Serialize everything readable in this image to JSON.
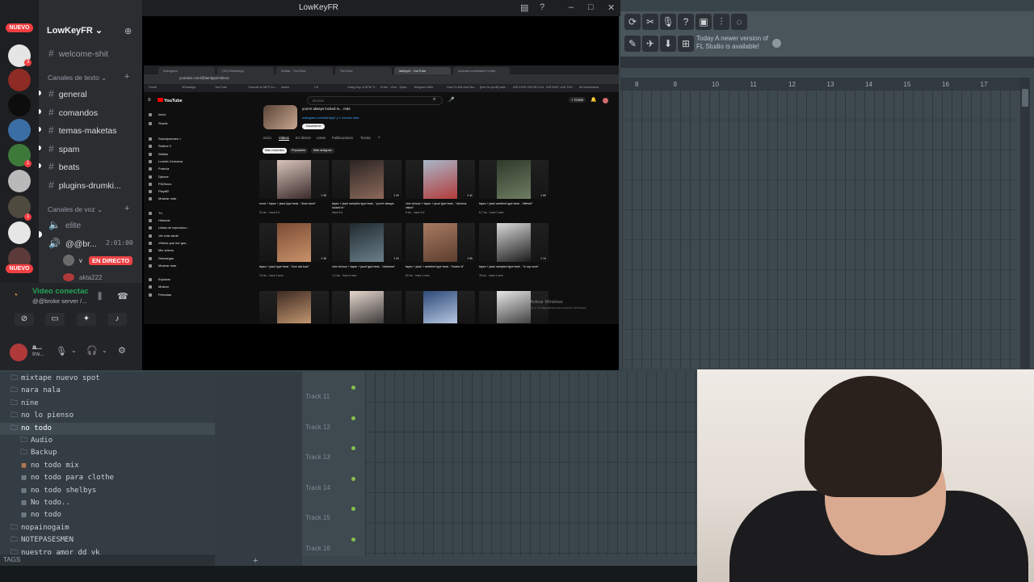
{
  "window": {
    "title": "LowKeyFR"
  },
  "discord": {
    "guild_name": "LowKeyFR ⌄",
    "nuevo_label": "NUEVO",
    "top_channel": "welcome-shit",
    "text_category": "Canales de texto ⌄",
    "text_channels": [
      "general",
      "comandos",
      "temas-maketas",
      "spam",
      "beats",
      "plugins-drumki..."
    ],
    "voice_category": "Canales de voz ⌄",
    "voice_channels": [
      "elite",
      "@@br..."
    ],
    "voice_time": "2:01:00",
    "live_user": "v",
    "live_label": "EN DIRECTO",
    "other_voice_user": "akta222",
    "server_badges": [
      "3",
      "1",
      "1"
    ],
    "voice_status": "Video conectac",
    "voice_server": "@@broke server /...",
    "user": {
      "name": "a...",
      "status": "Inv..."
    }
  },
  "fl": {
    "news_line1": "Today  A newer version of",
    "news_line2": "FL Studio is available!",
    "ruler": [
      "8",
      "9",
      "10",
      "11",
      "12",
      "13",
      "14",
      "15",
      "16",
      "17"
    ],
    "tracks": [
      "Track 11",
      "Track 12",
      "Track 13",
      "Track 14",
      "Track 15",
      "Track 16"
    ],
    "tags_label": "TAGS",
    "browser": [
      {
        "label": "mixtape nuevo spot",
        "icon": "folder",
        "indent": 0
      },
      {
        "label": "nara nala",
        "icon": "folder",
        "indent": 0
      },
      {
        "label": "nine",
        "icon": "folder",
        "indent": 0
      },
      {
        "label": "no lo pienso",
        "icon": "folder",
        "indent": 0
      },
      {
        "label": "no todo",
        "icon": "folder",
        "indent": 0,
        "selected": true
      },
      {
        "label": "Audio",
        "icon": "folder",
        "indent": 1
      },
      {
        "label": "Backup",
        "icon": "folder",
        "indent": 1
      },
      {
        "label": "no todo mix",
        "icon": "audio",
        "indent": 1
      },
      {
        "label": "no todo para clothe",
        "icon": "file",
        "indent": 1
      },
      {
        "label": "no todo shelbys",
        "icon": "file",
        "indent": 1
      },
      {
        "label": "No todo..",
        "icon": "file",
        "indent": 1
      },
      {
        "label": "no todo",
        "icon": "file",
        "indent": 1
      },
      {
        "label": "nopainogaim",
        "icon": "folder",
        "indent": 0
      },
      {
        "label": "NOTEPASESMEN",
        "icon": "folder",
        "indent": 0
      },
      {
        "label": "nuestro amor dd yk",
        "icon": "folder",
        "indent": 0
      }
    ]
  },
  "youtube": {
    "tabs": [
      "Instagram",
      "(19) WhatsApp",
      "Avatar - YouTube",
      "YouTube",
      "lainfpp2 - YouTube",
      "youtube.com/watch?v=6yl"
    ],
    "url": "youtube.com/@lainfpp2/videos",
    "bookmarks": [
      "Gmail",
      "WhatsApp",
      "YouTube",
      "Youtube to MP3 Co...",
      "lostcu",
      "C6",
      "Gang Boy & DPM Tr...",
      "Enter - Vine - Spoti...",
      "Telegram Web",
      "How To Mix And Ma...",
      "[free for profit] sele...",
      "ARCHIVE ENVIES #16",
      "INSTANT LAB THE...",
      "All Bookmarks"
    ],
    "logo": "YouTube",
    "search_placeholder": "Buscar",
    "create_label": "+ Crear",
    "sidebar": [
      "Inicio",
      "Shorts",
      "Suscripciones >",
      "Rubine 2",
      "Wallan",
      "Lucidio Cemarca",
      "Francia",
      "Djeone",
      "FNOboro",
      "Playlit0",
      "Mostrar más",
      "Tú",
      "Historial",
      "Listas de reproducc...",
      "Ver más tarde",
      "Videos que me gus...",
      "Mis videos",
      "Descargas",
      "Mostrar más",
      "Explorar",
      "Música",
      "Películas"
    ],
    "channel_name": "you're always locked in... más",
    "channel_link": "instagram.com/lainfpp2 y 1 vínculo más",
    "subscribe": "Suscribirme",
    "channel_tabs": [
      "Inicio",
      "Videos",
      "En directo",
      "Listas",
      "Publicaciones",
      "Tienda"
    ],
    "chips": [
      "Más recientes",
      "Populares",
      "Más antiguos"
    ],
    "videos": [
      {
        "title": "mxrd + tayso + jazul type beat - \"slow done\"",
        "meta": "32 vis. · hace 5 d",
        "dur": "2:38",
        "c1": "#d8c5bc",
        "c2": "#3b2a2a"
      },
      {
        "title": "tayso + jazul sampled type beat - \"you're always locked in\"",
        "meta": "Hace 6 d",
        "dur": "2:25",
        "c1": "#2b2423",
        "c2": "#8d6a5a"
      },
      {
        "title": "vtrw vicious + tayso + jazul type beat - \"obvious vision\"",
        "meta": "8 vis. · hace 9 d",
        "dur": "2:40",
        "c1": "#a9b7c9",
        "c2": "#b23b3b"
      },
      {
        "title": "tayso + jazul ambient type beat - \"offered\"",
        "meta": "6,7 vis. · hace 2 sem",
        "dur": "2:55",
        "c1": "#2e3a2b",
        "c2": "#6f7d62"
      },
      {
        "title": "tayso + jazul type beat - \"love dat bow\"",
        "meta": "13 vis. · hace 3 sem",
        "dur": "2:38",
        "c1": "#7b4b33",
        "c2": "#c9926b"
      },
      {
        "title": "vtrw vicious + tayso + jazul type beat - \"windows\"",
        "meta": "1,2 vis. · hace 4 sem",
        "dur": "2:25",
        "c1": "#1f2a2f",
        "c2": "#6b7f8a"
      },
      {
        "title": "tayso + jazul + ambient type beat - \"hearts id\"",
        "meta": "52 vis. · hace 1 mes",
        "dur": "2:55",
        "c1": "#a87b62",
        "c2": "#5c3d2e"
      },
      {
        "title": "tayso + jazul sampled type beat - \"in my room\"",
        "meta": "78 vis. · hace 1 mes",
        "dur": "2:19",
        "c1": "#d9d9d9",
        "c2": "#1b1b1b"
      },
      {
        "title": "",
        "meta": "",
        "dur": "",
        "c1": "#3d2a22",
        "c2": "#d4a57a"
      },
      {
        "title": "",
        "meta": "",
        "dur": "",
        "c1": "#e7d8cf",
        "c2": "#232323"
      },
      {
        "title": "",
        "meta": "",
        "dur": "",
        "c1": "#2d4a78",
        "c2": "#c9d9ef"
      },
      {
        "title": "",
        "meta": "",
        "dur": "",
        "c1": "#e8e8e8",
        "c2": "#2a2a2a"
      }
    ],
    "activate_title": "Activar Windows",
    "activate_sub": "Ve a Configuración para activar Windows."
  },
  "colors": {
    "discord_accent": "#f23f42",
    "voice_green": "#23a559",
    "live_red": "#ed4245",
    "fl_green": "#87c04d"
  }
}
